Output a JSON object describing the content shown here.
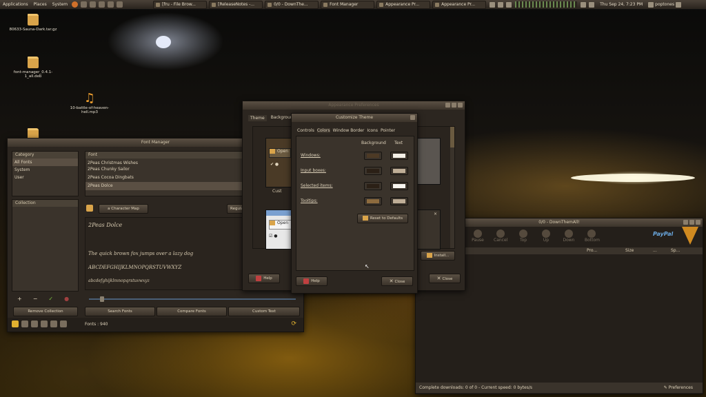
{
  "panel": {
    "menus": [
      "Applications",
      "Places",
      "System"
    ],
    "tasks": [
      "[fru - File Brow...",
      "[ReleaseNotes -...",
      "0/0 - DownThe...",
      "Font Manager",
      "Appearance Pr...",
      "Appearance Pr..."
    ],
    "clock": "Thu Sep 24,  7:23 PM",
    "user": "poptones"
  },
  "desktop": {
    "icons": [
      "80633-Sauna-Dark.tar.gz",
      "font-manager_0.4.1-1_all.deb",
      "10-battle-of-heaven-hell.mp3"
    ]
  },
  "font_manager": {
    "title": "Font Manager",
    "category_header": "Category",
    "categories": [
      "All Fonts",
      "System",
      "User"
    ],
    "collection_header": "Collection",
    "font_header": "Font",
    "fonts": [
      "2Peas Christmas Wishes",
      "2Peas Chunky Sailor",
      "2Peas Cocoa Dingbats",
      "2Peas Dolce"
    ],
    "character_map": "Character Map",
    "style": "Regular",
    "preview": {
      "name": "2Peas Dolce",
      "sentence": "The quick brown fox jumps over a lazy dog",
      "upper": "ABCDEFGHIJKLMNOPQRSTUVWXYZ",
      "lower": "abcdefghijklmnopqrstuvwxyz"
    },
    "collection_buttons": [
      "+",
      "−",
      "✓",
      "●"
    ],
    "remove_collection": "Remove Collection",
    "search_fonts": "Search Fonts",
    "compare_fonts": "Compare Fonts",
    "custom_text": "Custom Text",
    "status": "Fonts : 940"
  },
  "appearance": {
    "title": "Appearance Preferences",
    "tabs": [
      "Theme",
      "Background"
    ],
    "open_label": "Open",
    "help": "Help",
    "install": "Install...",
    "close": "Close",
    "customize": "Cust"
  },
  "customize": {
    "title": "Customize Theme",
    "tabs": [
      "Controls",
      "Colors",
      "Window Border",
      "Icons",
      "Pointer"
    ],
    "col_background": "Background",
    "col_text": "Text",
    "rows": [
      {
        "label": "Windows:",
        "bg": "#4d3a25",
        "fg": "#f3efe7"
      },
      {
        "label": "Input boxes:",
        "bg": "#2b2016",
        "fg": "#bfae97"
      },
      {
        "label": "Selected items:",
        "bg": "#2b2016",
        "fg": "#f7f5f0"
      },
      {
        "label": "Tooltips:",
        "bg": "#8d6b3e",
        "fg": "#bfae97"
      }
    ],
    "reset": "Reset to Defaults",
    "help": "Help",
    "close": "Close"
  },
  "downthemall": {
    "title": "0/0 - DownThemAll!",
    "toolbar": [
      "Pause",
      "Cancel",
      "Top",
      "Up",
      "Down",
      "Bottom"
    ],
    "paypal": "PayPal",
    "columns": [
      "Pro...",
      "Size",
      "...",
      "Sp..."
    ],
    "status": "Complete downloads: 0 of 0 - Current speed: 0 bytes/s",
    "preferences": "Preferences"
  }
}
